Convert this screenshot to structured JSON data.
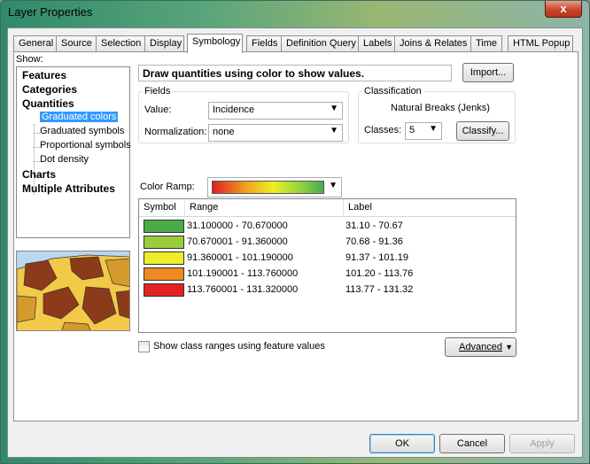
{
  "window": {
    "title": "Layer Properties",
    "close_glyph": "x"
  },
  "tabs": [
    "General",
    "Source",
    "Selection",
    "Display",
    "Symbology",
    "Fields",
    "Definition Query",
    "Labels",
    "Joins & Relates",
    "Time",
    "HTML Popup"
  ],
  "active_tab": "Symbology",
  "show": {
    "label": "Show:",
    "categories": [
      "Features",
      "Categories",
      "Quantities",
      "Charts",
      "Multiple Attributes"
    ],
    "quantities_items": [
      "Graduated colors",
      "Graduated symbols",
      "Proportional symbols",
      "Dot density"
    ],
    "selected_item": "Graduated colors"
  },
  "description": "Draw quantities using color to show values.",
  "import_button": "Import...",
  "fields": {
    "group_title": "Fields",
    "value_label": "Value:",
    "value": "Incidence",
    "normalization_label": "Normalization:",
    "normalization": "none"
  },
  "classification": {
    "group_title": "Classification",
    "method": "Natural Breaks (Jenks)",
    "classes_label": "Classes:",
    "classes": "5",
    "classify_button": "Classify..."
  },
  "color_ramp": {
    "label": "Color Ramp:",
    "colors": [
      "#e02020",
      "#f0a020",
      "#f0f020",
      "#90d040",
      "#4aad4a"
    ]
  },
  "class_table": {
    "headers": [
      "Symbol",
      "Range",
      "Label"
    ],
    "rows": [
      {
        "color": "#4aad4a",
        "range": "31.100000 - 70.670000",
        "label": "31.10 - 70.67"
      },
      {
        "color": "#9acd3c",
        "range": "70.670001 - 91.360000",
        "label": "70.68 - 91.36"
      },
      {
        "color": "#eded2a",
        "range": "91.360001 - 101.190000",
        "label": "91.37 - 101.19"
      },
      {
        "color": "#ee8a22",
        "range": "101.190001 - 113.760000",
        "label": "101.20 - 113.76"
      },
      {
        "color": "#e52222",
        "range": "113.760001 - 131.320000",
        "label": "113.77 - 131.32"
      }
    ]
  },
  "show_ranges_checkbox": "Show class ranges using feature values",
  "advanced_button": "Advanced",
  "footer": {
    "ok": "OK",
    "cancel": "Cancel",
    "apply": "Apply"
  }
}
